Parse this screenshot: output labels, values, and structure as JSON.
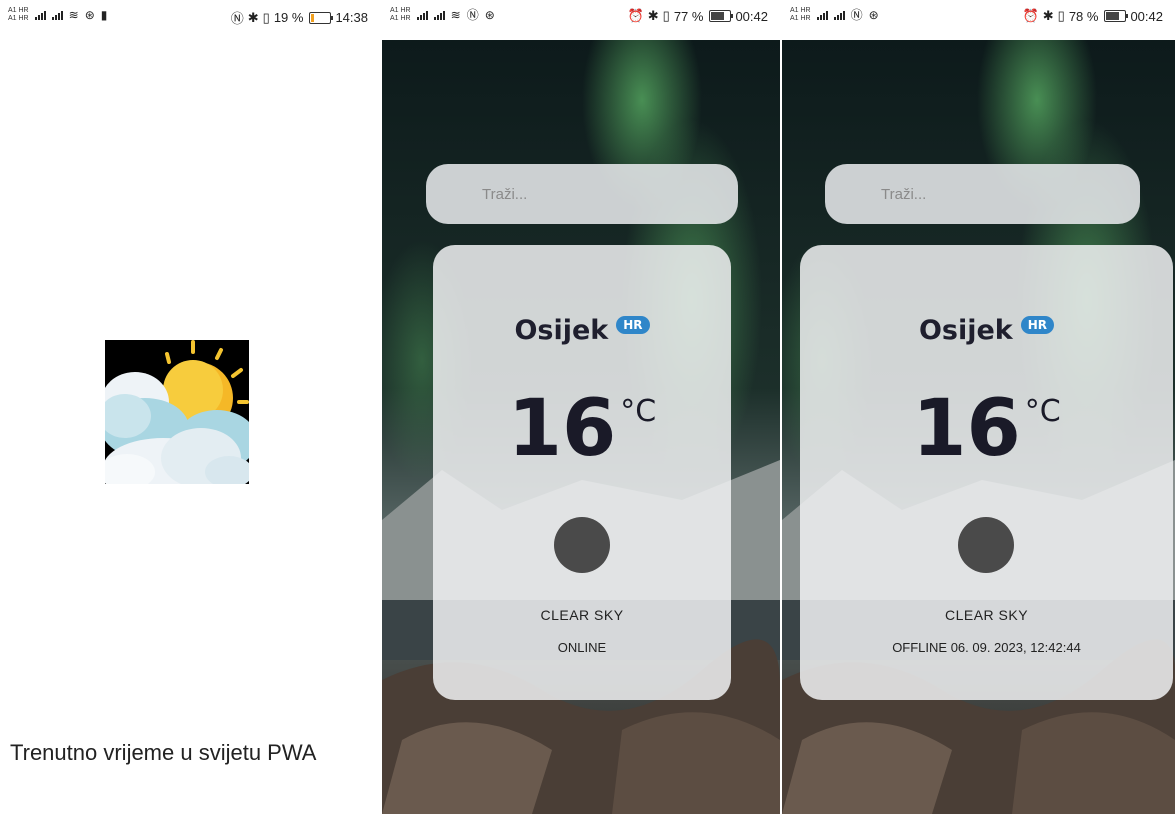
{
  "screens": [
    {
      "status": {
        "carrier": "A1 HR",
        "battery": "19 %",
        "time": "14:38",
        "battery_level": 0.19
      },
      "splash": {
        "caption": "Trenutno vrijeme u svijetu PWA",
        "icon": "sun-behind-clouds-icon"
      }
    },
    {
      "status": {
        "carrier": "A1 HR",
        "battery": "77 %",
        "time": "00:42",
        "battery_level": 0.77
      },
      "search": {
        "placeholder": "Traži..."
      },
      "weather": {
        "city": "Osijek",
        "country": "HR",
        "temp": "16",
        "unit": "°C",
        "description": "CLEAR SKY",
        "status": "ONLINE"
      }
    },
    {
      "status": {
        "carrier": "A1 HR",
        "battery": "78 %",
        "time": "00:42",
        "battery_level": 0.78
      },
      "search": {
        "placeholder": "Traži..."
      },
      "weather": {
        "city": "Osijek",
        "country": "HR",
        "temp": "16",
        "unit": "°C",
        "description": "CLEAR SKY",
        "status": "OFFLINE 06. 09. 2023, 12:42:44"
      }
    }
  ],
  "colors": {
    "badge": "#2f86c9",
    "card": "#f0f1f2",
    "sky": "#0e1e1c",
    "aurora": "#3e8f50"
  }
}
